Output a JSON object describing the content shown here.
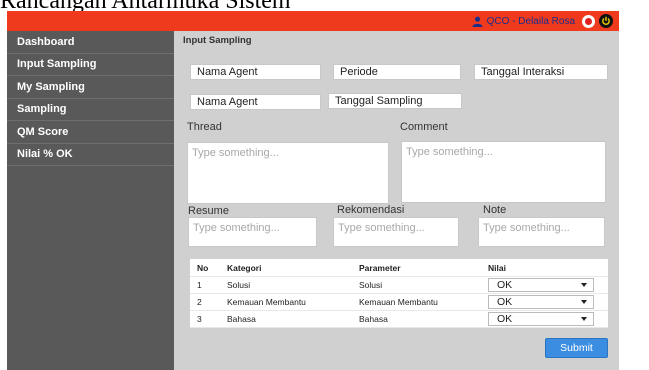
{
  "caption": "Rancangan Antarmuka Sistem",
  "header": {
    "user_text": "QCO - Delaila Rosa"
  },
  "sidebar": {
    "items": [
      {
        "label": "Dashboard"
      },
      {
        "label": "Input Sampling"
      },
      {
        "label": "My Sampling"
      },
      {
        "label": "Sampling"
      },
      {
        "label": "QM Score"
      },
      {
        "label": "Nilai % OK"
      }
    ]
  },
  "main": {
    "section_title": "Input Sampling",
    "fields": {
      "nama_agent_1": "Nama Agent",
      "periode": "Periode",
      "tanggal_interaksi": "Tanggal Interaksi",
      "nama_agent_2": "Nama Agent",
      "tanggal_sampling": "Tanggal Sampling"
    },
    "labels": {
      "thread": "Thread",
      "comment": "Comment",
      "resume": "Resume",
      "rekomendasi": "Rekomendasi",
      "note": "Note"
    },
    "placeholders": {
      "thread": "Type something...",
      "comment": "Type something...",
      "resume": "Type something...",
      "rekomendasi": "Type something...",
      "note": "Type something..."
    },
    "table": {
      "headers": {
        "no": "No",
        "kategori": "Kategori",
        "parameter": "Parameter",
        "nilai": "Nilai"
      },
      "rows": [
        {
          "no": "1",
          "kategori": "Solusi",
          "parameter": "Solusi",
          "nilai": "OK"
        },
        {
          "no": "2",
          "kategori": "Kemauan Membantu",
          "parameter": "Kemauan Membantu",
          "nilai": "OK"
        },
        {
          "no": "3",
          "kategori": "Bahasa",
          "parameter": "Bahasa",
          "nilai": "OK"
        }
      ]
    },
    "submit_label": "Submit"
  },
  "colors": {
    "header_bg": "#f03a1e",
    "sidebar_bg": "#595959",
    "content_bg": "#d0d0d0",
    "submit_bg": "#3a8de0"
  }
}
